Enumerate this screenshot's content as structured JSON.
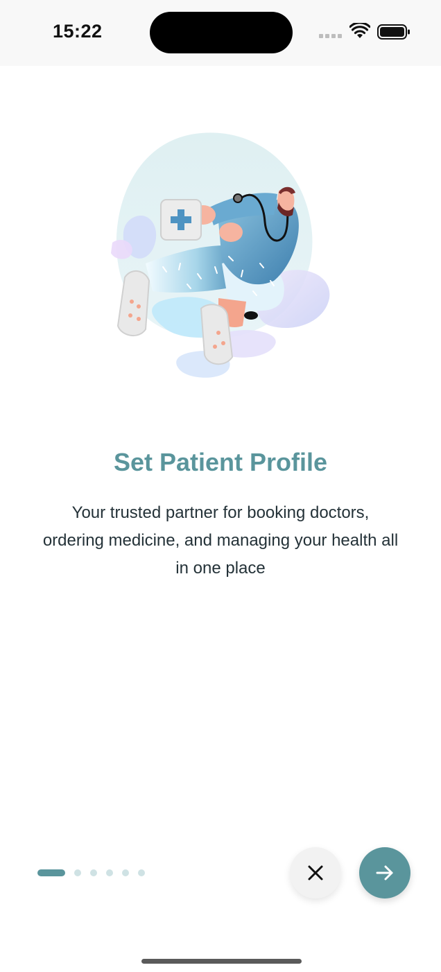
{
  "status_bar": {
    "time": "15:22",
    "icons": [
      "cellular-signal-icon",
      "wifi-icon",
      "battery-icon"
    ]
  },
  "onboarding": {
    "illustration": "doctor-running-with-medical-kit",
    "title": "Set Patient Profile",
    "description": "Your trusted partner for booking doctors, ordering medicine, and managing your health all in one place",
    "pagination": {
      "total_pages": 6,
      "current_page": 1
    }
  },
  "controls": {
    "close_icon": "close-icon",
    "next_icon": "arrow-right-icon"
  },
  "colors": {
    "accent": "#5a959c",
    "inactive_dot": "#cfe2e4",
    "text": "#243238",
    "close_button_bg": "#f2f2f2"
  }
}
